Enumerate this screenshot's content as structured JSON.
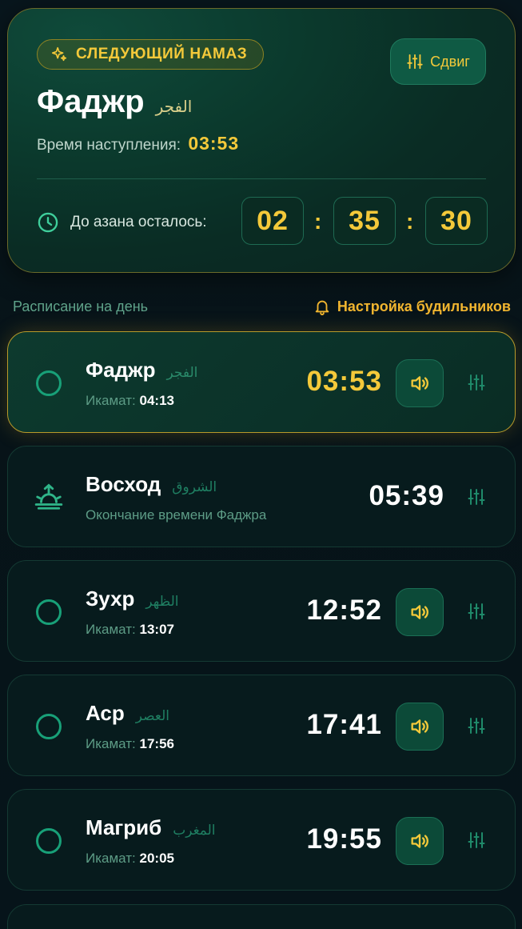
{
  "hero": {
    "badge": "СЛЕДУЮЩИЙ НАМАЗ",
    "shift_label": "Сдвиг",
    "prayer_name": "Фаджр",
    "prayer_name_ar": "الفجر",
    "time_label": "Время наступления:",
    "time_value": "03:53",
    "countdown_label": "До азана осталось:",
    "countdown": {
      "hours": "02",
      "minutes": "35",
      "seconds": "30",
      "separator": ":"
    }
  },
  "schedule": {
    "title": "Расписание на день",
    "alarm_settings": "Настройка будильников",
    "iqamah_label": "Икамат:",
    "prayers": [
      {
        "name": "Фаджр",
        "name_ar": "الفجر",
        "time": "03:53",
        "iqamah": "04:13",
        "active": true
      },
      {
        "name": "Восход",
        "name_ar": "الشروق",
        "time": "05:39",
        "note": "Окончание времени Фаджра"
      },
      {
        "name": "Зухр",
        "name_ar": "الظهر",
        "time": "12:52",
        "iqamah": "13:07"
      },
      {
        "name": "Аср",
        "name_ar": "العصر",
        "time": "17:41",
        "iqamah": "17:56"
      },
      {
        "name": "Магриб",
        "name_ar": "المغرب",
        "time": "19:55",
        "iqamah": "20:05"
      }
    ]
  },
  "colors": {
    "accent_gold": "#f4c93a",
    "accent_green": "#18a078",
    "background": "#06131a"
  },
  "icons": [
    "sparkle-icon",
    "tune-icon",
    "clock-icon",
    "bell-icon",
    "sunrise-icon",
    "speaker-icon"
  ]
}
